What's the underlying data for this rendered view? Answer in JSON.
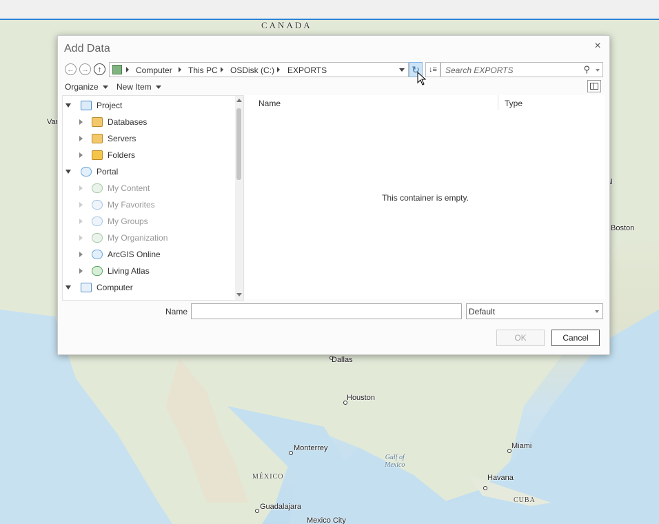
{
  "map": {
    "labels": {
      "canada": "CANADA",
      "mexico": "MÉXICO",
      "gulf": "Gulf of\nMexico",
      "dallas": "Dallas",
      "houston": "Houston",
      "monterrey": "Monterrey",
      "miami": "Miami",
      "havana": "Havana",
      "cuba": "CUBA",
      "guadalajara": "Guadalajara",
      "mexico_city": "Mexico City",
      "boston": "Boston",
      "van": "Van",
      "al": "al"
    }
  },
  "dialog": {
    "title": "Add Data",
    "close": "×",
    "nav": {
      "back": "←",
      "forward": "→",
      "up": "↑"
    },
    "breadcrumb": [
      "Computer",
      "This PC",
      "OSDisk (C:)",
      "EXPORTS"
    ],
    "search_placeholder": "Search EXPORTS",
    "toolbar": {
      "organize": "Organize",
      "new_item": "New Item"
    },
    "tree": [
      {
        "label": "Project",
        "icon": "project-icon",
        "expanded": true,
        "level": 0
      },
      {
        "label": "Databases",
        "icon": "databases-icon",
        "expanded": false,
        "level": 1
      },
      {
        "label": "Servers",
        "icon": "servers-icon",
        "expanded": false,
        "level": 1
      },
      {
        "label": "Folders",
        "icon": "folders-icon",
        "expanded": false,
        "level": 1
      },
      {
        "label": "Portal",
        "icon": "portal-icon",
        "expanded": true,
        "level": 0
      },
      {
        "label": "My Content",
        "icon": "my-content-icon",
        "expanded": false,
        "level": 1,
        "dim": true
      },
      {
        "label": "My Favorites",
        "icon": "my-favorites-icon",
        "expanded": false,
        "level": 1,
        "dim": true
      },
      {
        "label": "My Groups",
        "icon": "my-groups-icon",
        "expanded": false,
        "level": 1,
        "dim": true
      },
      {
        "label": "My Organization",
        "icon": "my-organization-icon",
        "expanded": false,
        "level": 1,
        "dim": true
      },
      {
        "label": "ArcGIS Online",
        "icon": "arcgis-online-icon",
        "expanded": false,
        "level": 1
      },
      {
        "label": "Living Atlas",
        "icon": "living-atlas-icon",
        "expanded": false,
        "level": 1
      },
      {
        "label": "Computer",
        "icon": "computer-icon",
        "expanded": true,
        "level": 0
      }
    ],
    "columns": {
      "name": "Name",
      "type": "Type"
    },
    "empty_message": "This container is empty.",
    "name_label": "Name",
    "name_value": "",
    "filter_value": "Default",
    "ok": "OK",
    "cancel": "Cancel"
  },
  "colors": {
    "accent": "#2c82d6",
    "refresh_bg": "#cde4f7"
  }
}
